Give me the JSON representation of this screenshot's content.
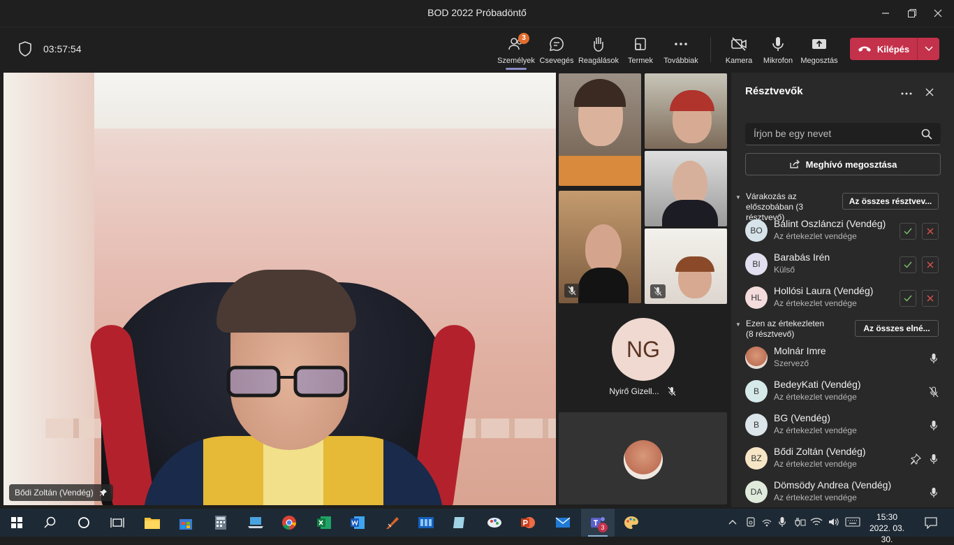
{
  "window": {
    "title": "BOD 2022 Próbadöntő"
  },
  "toolbar": {
    "timer": "03:57:54",
    "items": [
      {
        "label": "Személyek",
        "badge": "3"
      },
      {
        "label": "Csevegés"
      },
      {
        "label": "Reagálások"
      },
      {
        "label": "Termek"
      },
      {
        "label": "Továbbiak"
      },
      {
        "label": "Kamera"
      },
      {
        "label": "Mikrofon"
      },
      {
        "label": "Megosztás"
      }
    ],
    "leave_label": "Kilépés"
  },
  "stage": {
    "participant_label": "Bődi Zoltán (Vendég)"
  },
  "gallery": {
    "ng_initials": "NG",
    "ng_name": "Nyirő Gizell..."
  },
  "panel": {
    "title": "Résztvevők",
    "search_placeholder": "Írjon be egy nevet",
    "invite_label": "Meghívó megosztása",
    "lobby": {
      "title": "Várakozás az előszobában (3 résztvevő)",
      "button": "Az összes résztvev...",
      "people": [
        {
          "initials": "BO",
          "name": "Bálint Oszlánczi (Vendég)",
          "role": "Az értekezlet vendége",
          "color": "#d6e4ea"
        },
        {
          "initials": "BI",
          "name": "Barabás Irén",
          "role": "Külső",
          "color": "#e2dff0"
        },
        {
          "initials": "HL",
          "name": "Hollósi Laura (Vendég)",
          "role": "Az értekezlet vendége",
          "color": "#f4dcdc"
        }
      ]
    },
    "meeting": {
      "title": "Ezen az értekezleten (8 résztvevő)",
      "button": "Az összes elné...",
      "people": [
        {
          "initials": "",
          "name": "Molnár Imre",
          "role": "Szervező",
          "color": "#c8826a"
        },
        {
          "initials": "B",
          "name": "BedeyKati (Vendég)",
          "role": "Az értekezlet vendége",
          "color": "#d6eaea"
        },
        {
          "initials": "B",
          "name": "BG (Vendég)",
          "role": "Az értekezlet vendége",
          "color": "#dbe5ea"
        },
        {
          "initials": "BZ",
          "name": "Bődi Zoltán (Vendég)",
          "role": "Az értekezlet vendége",
          "color": "#f6e6c6"
        },
        {
          "initials": "DA",
          "name": "Dömsödy Andrea (Vendég)",
          "role": "Az értekezlet vendége",
          "color": "#dfeadb"
        }
      ]
    }
  },
  "taskbar": {
    "time": "15:30",
    "date": "2022. 03. 30.",
    "teams_badge": "3"
  }
}
